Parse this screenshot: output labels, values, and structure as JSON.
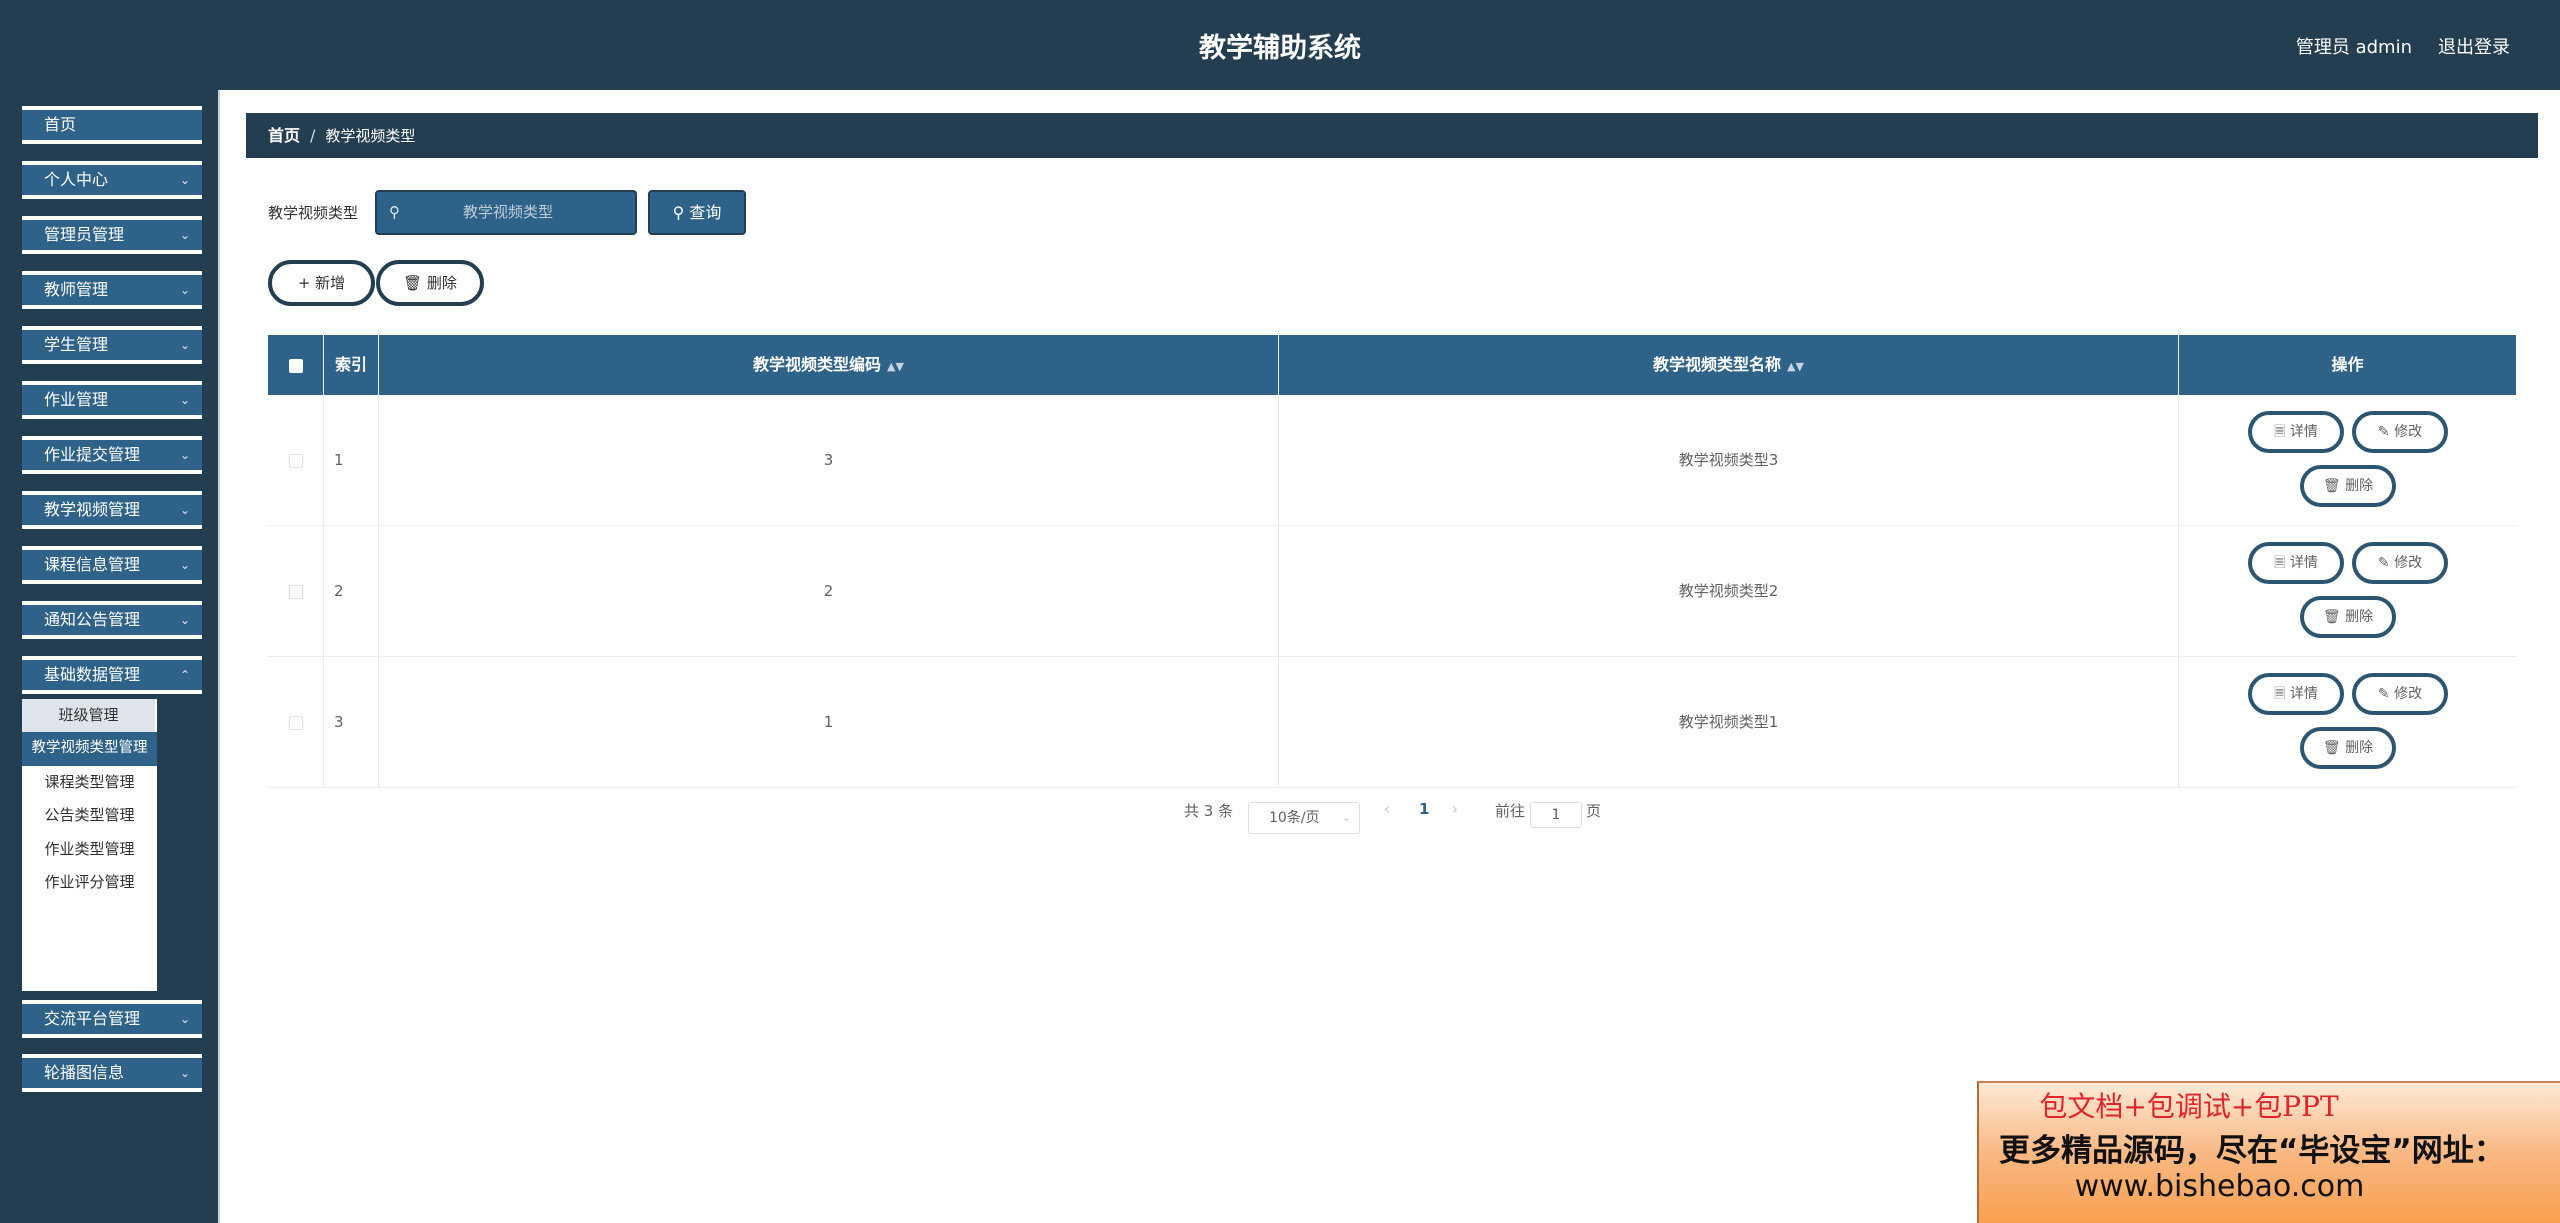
{
  "header": {
    "title": "教学辅助系统",
    "user": "管理员 admin",
    "logout": "退出登录"
  },
  "sidebar": {
    "items": [
      {
        "label": "首页",
        "has_arrow": false
      },
      {
        "label": "个人中心",
        "has_arrow": true
      },
      {
        "label": "管理员管理",
        "has_arrow": true
      },
      {
        "label": "教师管理",
        "has_arrow": true
      },
      {
        "label": "学生管理",
        "has_arrow": true
      },
      {
        "label": "作业管理",
        "has_arrow": true
      },
      {
        "label": "作业提交管理",
        "has_arrow": true
      },
      {
        "label": "教学视频管理",
        "has_arrow": true
      },
      {
        "label": "课程信息管理",
        "has_arrow": true
      },
      {
        "label": "通知公告管理",
        "has_arrow": true
      },
      {
        "label": "基础数据管理",
        "has_arrow": true
      },
      {
        "label": "交流平台管理",
        "has_arrow": true
      },
      {
        "label": "轮播图信息",
        "has_arrow": true
      }
    ],
    "submenu": [
      "班级管理",
      "教学视频类型管理",
      "课程类型管理",
      "公告类型管理",
      "作业类型管理",
      "作业评分管理"
    ],
    "active_submenu": "教学视频类型管理"
  },
  "breadcrumb": {
    "home": "首页",
    "separator": "/",
    "current": "教学视频类型"
  },
  "search": {
    "label": "教学视频类型",
    "placeholder": "教学视频类型",
    "button": "查询"
  },
  "toolbar": {
    "add": "新增",
    "delete": "删除"
  },
  "table": {
    "columns": [
      "索引",
      "教学视频类型编码",
      "教学视频类型名称",
      "操作"
    ],
    "rows": [
      {
        "index": "1",
        "code": "3",
        "name": "教学视频类型3"
      },
      {
        "index": "2",
        "code": "2",
        "name": "教学视频类型2"
      },
      {
        "index": "3",
        "code": "1",
        "name": "教学视频类型1"
      }
    ],
    "actions": {
      "detail": "详情",
      "edit": "修改",
      "delete": "删除"
    }
  },
  "pagination": {
    "total": "共 3 条",
    "page_size": "10条/页",
    "current_page": "1",
    "goto_label": "前往",
    "goto_value": "1",
    "page_unit": "页"
  },
  "banner": {
    "line1": "包文档+包调试+包PPT",
    "line2": "更多精品源码，尽在“毕设宝”网址：",
    "line3": "www.bishebao.com"
  },
  "colors": {
    "header": "#233d51",
    "accent": "#2f6289",
    "banner_red": "#e0262b"
  }
}
